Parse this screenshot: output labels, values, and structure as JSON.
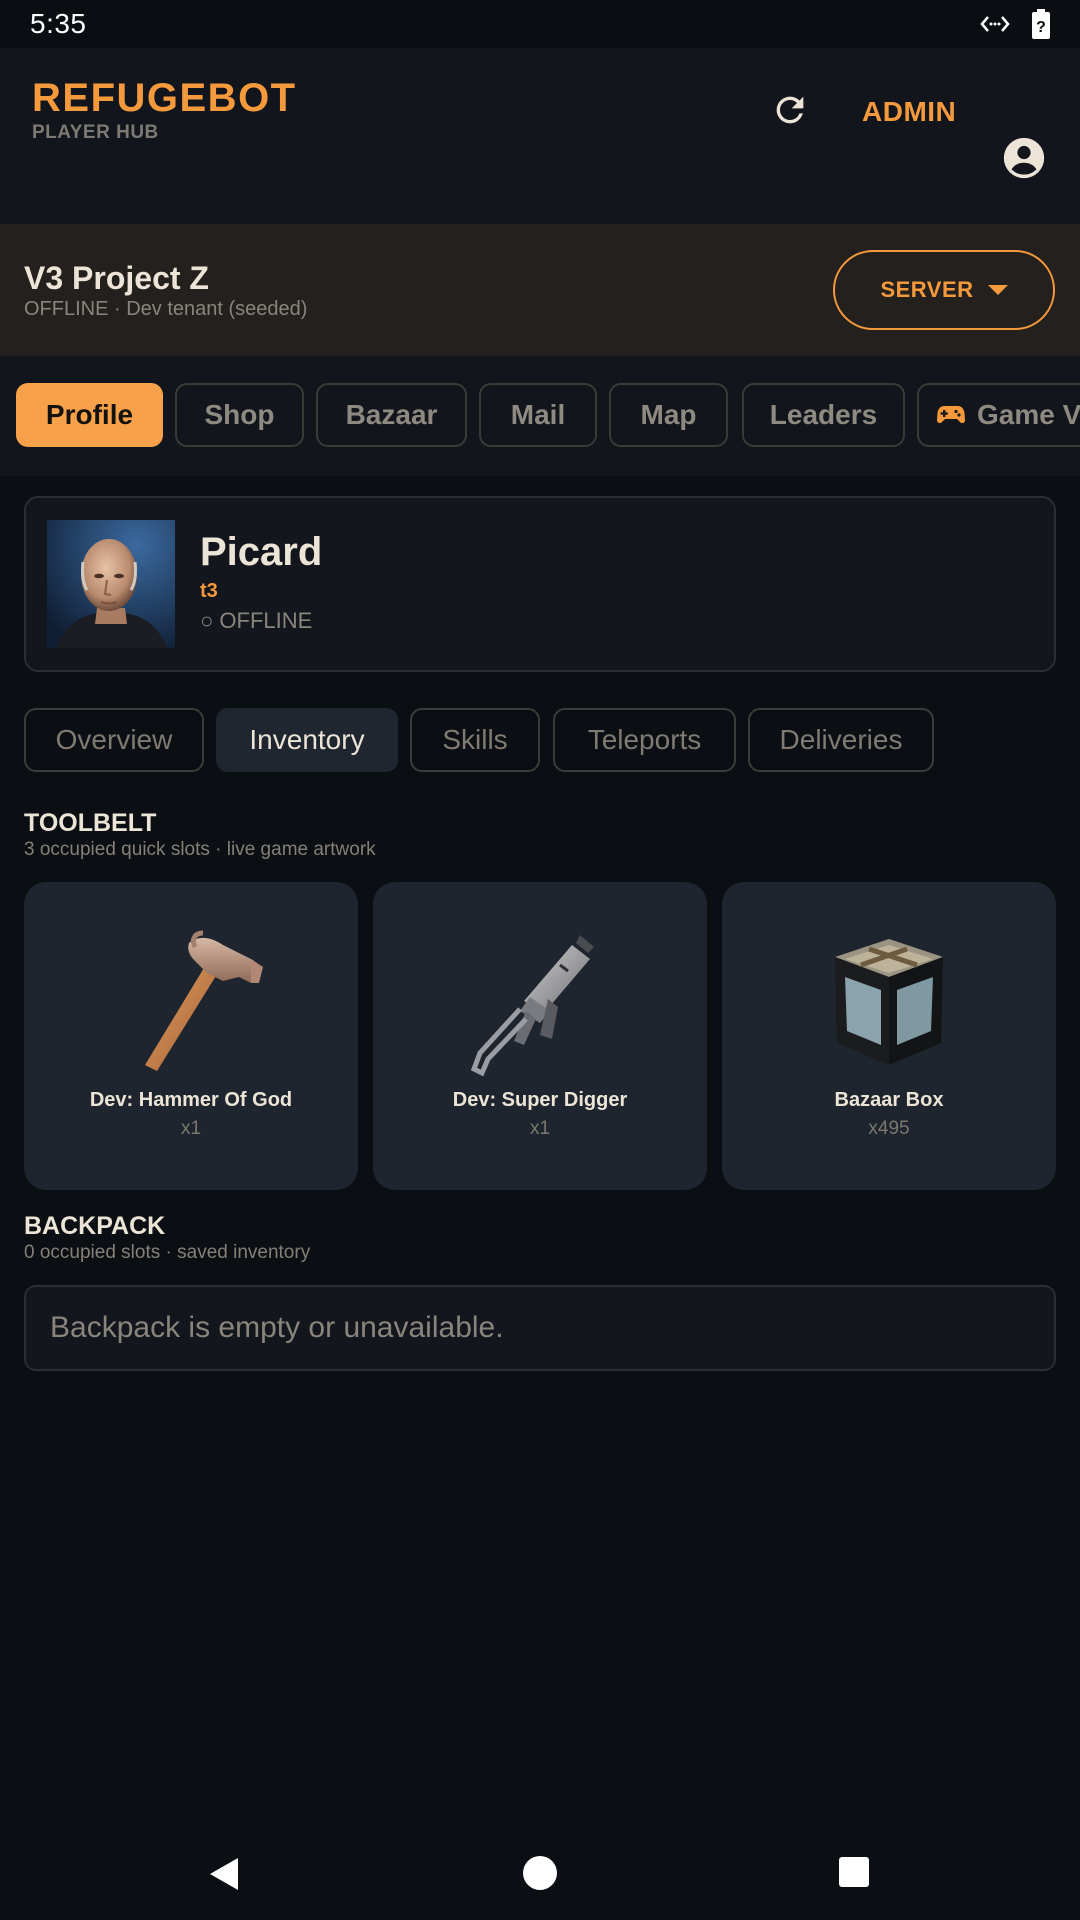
{
  "status_bar": {
    "time": "5:35",
    "icons": [
      "code-brackets-icon",
      "battery-unknown-icon"
    ]
  },
  "header": {
    "title": "REFUGEBOT",
    "subtitle": "PLAYER HUB",
    "refresh_icon": "refresh-icon",
    "admin_label": "ADMIN",
    "account_icon": "account-circle-icon"
  },
  "server": {
    "name": "V3 Project Z",
    "status": "OFFLINE · Dev tenant (seeded)",
    "button_label": "SERVER"
  },
  "nav": {
    "tabs": [
      {
        "label": "Profile",
        "active": true
      },
      {
        "label": "Shop"
      },
      {
        "label": "Bazaar"
      },
      {
        "label": "Mail"
      },
      {
        "label": "Map"
      },
      {
        "label": "Leaders"
      },
      {
        "label": "Game V",
        "icon": "gamepad-icon"
      }
    ]
  },
  "player": {
    "name": "Picard",
    "tag": "t3",
    "status": "○ OFFLINE"
  },
  "subtabs": [
    "Overview",
    "Inventory",
    "Skills",
    "Teleports",
    "Deliveries"
  ],
  "active_subtab": "Inventory",
  "toolbelt": {
    "title": "TOOLBELT",
    "subtitle": "3 occupied quick slots · live game artwork",
    "items": [
      {
        "name": "Dev: Hammer Of God",
        "qty": "x1",
        "icon": "hammer-icon"
      },
      {
        "name": "Dev: Super Digger",
        "qty": "x1",
        "icon": "smg-icon"
      },
      {
        "name": "Bazaar Box",
        "qty": "x495",
        "icon": "crate-icon"
      }
    ]
  },
  "backpack": {
    "title": "BACKPACK",
    "subtitle": "0 occupied slots · saved inventory",
    "empty_text": "Backpack is empty or unavailable."
  },
  "system_nav": {
    "back_icon": "back-icon",
    "home_icon": "home-icon",
    "recents_icon": "recents-icon"
  },
  "colors": {
    "accent": "#f59a3c",
    "background": "#0b0e13",
    "card": "#1e252e"
  }
}
